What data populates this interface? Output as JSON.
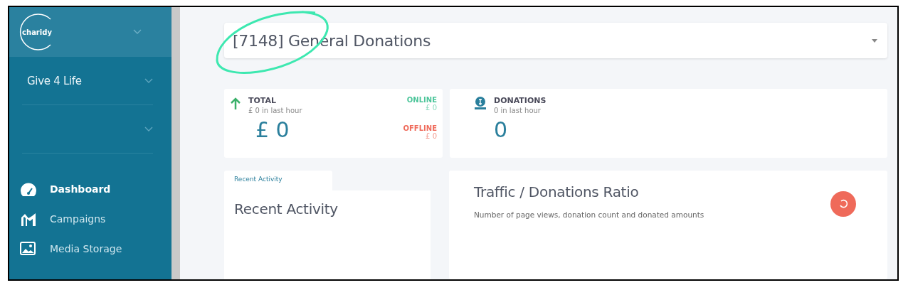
{
  "sidebar": {
    "logo": "charidy",
    "org_selector": {
      "label": "Give 4 Life"
    },
    "menu": [
      {
        "label": "Dashboard",
        "kind": "dashboard",
        "selected": true
      },
      {
        "label": "Campaigns",
        "kind": "campaigns",
        "selected": false
      },
      {
        "label": "Media Storage",
        "kind": "media",
        "selected": false
      }
    ]
  },
  "campaign_select": {
    "value": "[7148] General Donations"
  },
  "total_card": {
    "title": "TOTAL",
    "subtitle": "£ 0 in last hour",
    "value": "£ 0",
    "online_label": "ONLINE",
    "online_value": "£ 0",
    "offline_label": "OFFLINE",
    "offline_value": "£ 0"
  },
  "donations_card": {
    "title": "DONATIONS",
    "subtitle": "0 in last hour",
    "value": "0"
  },
  "recent_activity": {
    "tab": "Recent Activity",
    "title": "Recent Activity"
  },
  "traffic_card": {
    "title": "Traffic / Donations Ratio",
    "subtitle": "Number of page views, donation count and donated amounts"
  }
}
